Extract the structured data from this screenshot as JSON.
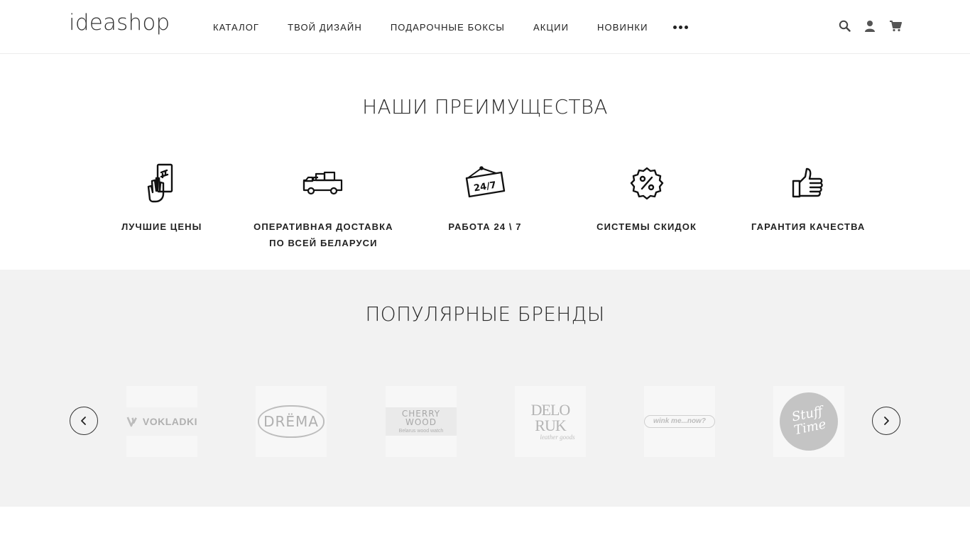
{
  "header": {
    "logo": "ideashop",
    "nav": [
      "КАТАЛОГ",
      "ТВОЙ ДИЗАЙН",
      "ПОДАРОЧНЫЕ БОКСЫ",
      "АКЦИИ",
      "НОВИНКИ"
    ],
    "icons": [
      "search-icon",
      "user-icon",
      "cart-icon"
    ]
  },
  "advantages": {
    "title": "НАШИ ПРЕИМУЩЕСТВА",
    "items": [
      {
        "icon": "money-hand-icon",
        "label": "ЛУЧШИЕ ЦЕНЫ"
      },
      {
        "icon": "delivery-truck-icon",
        "label": "ОПЕРАТИВНАЯ ДОСТАВКА\nПО ВСЕЙ БЕЛАРУСИ"
      },
      {
        "icon": "sign-24-7-icon",
        "label": "РАБОТА 24 \\ 7",
        "sign_text": "24/7"
      },
      {
        "icon": "discount-badge-icon",
        "label": "СИСТЕМЫ СКИДОК"
      },
      {
        "icon": "thumbs-up-icon",
        "label": "ГАРАНТИЯ КАЧЕСТВА"
      }
    ]
  },
  "brands": {
    "title": "ПОПУЛЯРНЫЕ БРЕНДЫ",
    "logos": [
      {
        "name": "VOKLADKI",
        "sub": ""
      },
      {
        "name": "DRЁMA",
        "sub": ""
      },
      {
        "name": "CHERRY WOOD",
        "sub": "Belarus wood watch"
      },
      {
        "name": "DELO RUK",
        "sub": "leather goods"
      },
      {
        "name": "wink me...now?",
        "sub": ""
      },
      {
        "name": "Stuff Time",
        "sub": ""
      }
    ]
  },
  "colors": {
    "text": "#222222",
    "brands_bg": "#f2f2f2",
    "logo_gray": "#b8b8b8"
  }
}
